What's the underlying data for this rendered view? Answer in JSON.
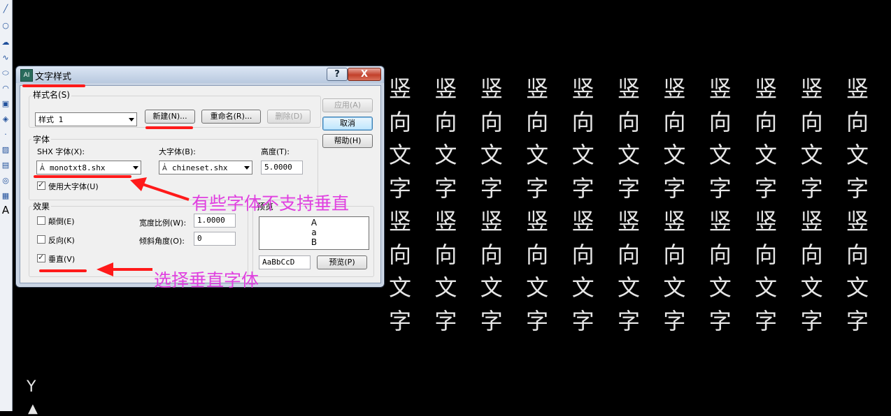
{
  "dialog": {
    "title": "文字样式",
    "help_btn": "?",
    "close_btn": "X",
    "style_name_group": "样式名(S)",
    "style_select_value": "样式 1",
    "new_btn": "新建(N)...",
    "rename_btn": "重命名(R)...",
    "delete_btn": "删除(D)",
    "apply_btn": "应用(A)",
    "cancel_btn": "取消",
    "help_text_btn": "帮助(H)",
    "font_group": "字体",
    "shx_font_label": "SHX 字体(X):",
    "shx_font_value": "monotxt8.shx",
    "big_font_label": "大字体(B):",
    "big_font_value": "chineset.shx",
    "height_label": "高度(T):",
    "height_value": "5.0000",
    "use_big_font_label": "使用大字体(U)",
    "use_big_font_checked": true,
    "effects_group": "效果",
    "upside_down_label": "颠倒(E)",
    "upside_down_checked": false,
    "backwards_label": "反向(K)",
    "backwards_checked": false,
    "vertical_label": "垂直(V)",
    "vertical_checked": true,
    "width_factor_label": "宽度比例(W):",
    "width_factor_value": "1.0000",
    "oblique_label": "倾斜角度(O):",
    "oblique_value": "0",
    "preview_group": "预览",
    "preview_glyphs": [
      "A",
      "a",
      "B"
    ],
    "preview_input_value": "AaBbCcD",
    "preview_btn": "预览(P)"
  },
  "annotations": {
    "font_note": "有些字体不支持垂直",
    "vertical_note": "选择垂直字体",
    "color": "#e040e0",
    "arrow_color": "#ff1a1a"
  },
  "canvas": {
    "vertical_text": [
      "竖",
      "向",
      "文",
      "字",
      "竖",
      "向",
      "文",
      "字"
    ],
    "column_count": 11,
    "ucs_label": "Y",
    "text_color": "#e6e6e6",
    "background": "#000000"
  },
  "toolbar": {
    "icons": [
      "line-icon",
      "circle-icon",
      "cloud-icon",
      "spline-icon",
      "ellipse-icon",
      "ellipse-arc-icon",
      "insert-block-icon",
      "make-block-icon",
      "point-icon",
      "hatch-icon",
      "gradient-icon",
      "region-icon",
      "table-icon",
      "text-icon"
    ],
    "text_tool_glyph": "A"
  }
}
